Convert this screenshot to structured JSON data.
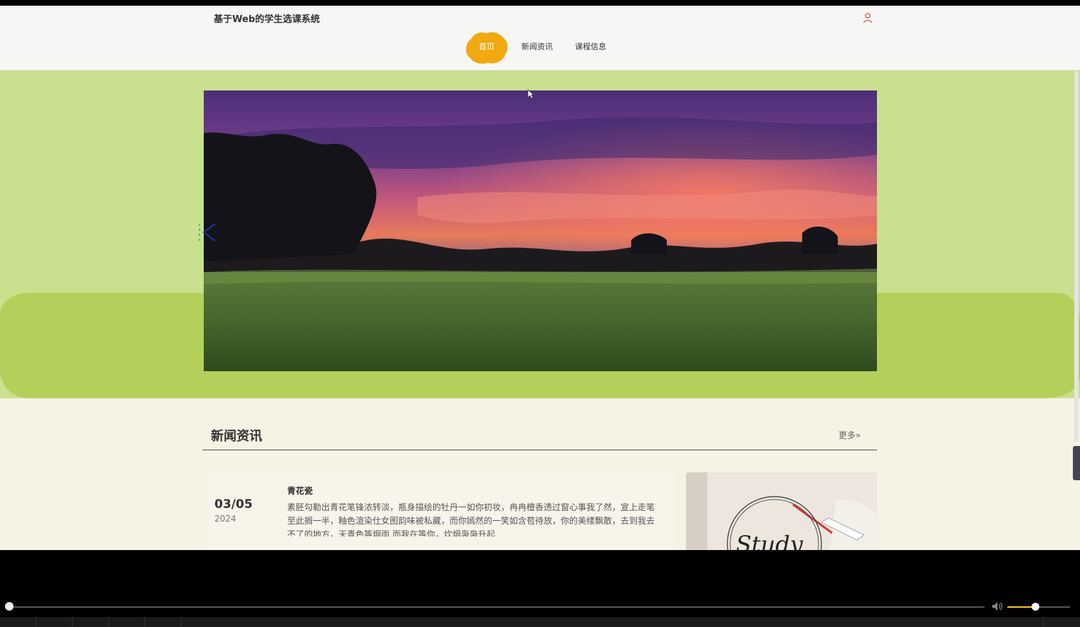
{
  "header": {
    "site_title": "基于Web的学生选课系统"
  },
  "nav": {
    "items": [
      {
        "label": "首页",
        "active": true
      },
      {
        "label": "新闻资讯",
        "active": false
      },
      {
        "label": "课程信息",
        "active": false
      }
    ]
  },
  "news": {
    "section_title": "新闻资讯",
    "more_label": "更多»",
    "items": [
      {
        "date": "03/05",
        "year": "2024",
        "title": "青花瓷",
        "text": "素胚勾勒出青花笔锋浓转淡，瓶身描绘的牡丹一如你初妆，冉冉檀香透过窗心事我了然，宣上走笔至此搁一半，釉色渲染仕女图韵味被私藏，而你嫣然的一笑如含苞待放，你的美缕飘散，去到我去不了的地方，天青色等烟雨 而我在等你，炊烟袅袅升起"
      }
    ],
    "image_text": "Study"
  },
  "player": {
    "progress": 0.0,
    "volume": 0.45
  },
  "colors": {
    "accent": "#f2a80f",
    "hero_light": "#c9e08f",
    "hero_band": "#b5d05a",
    "page_bg": "#f5f3e4"
  }
}
